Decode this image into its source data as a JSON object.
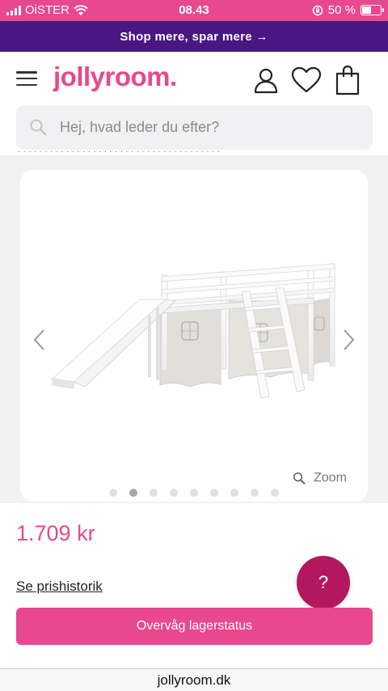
{
  "status_bar": {
    "carrier": "OiSTER",
    "time": "08.43",
    "battery_percent": "50 %",
    "battery_level": 0.5
  },
  "promo": {
    "text": "Shop mere, spar mere →"
  },
  "header": {
    "logo": "jollyroom.",
    "brand_color": "#e8488d"
  },
  "search": {
    "placeholder": "Hej, hvad leder du efter?"
  },
  "gallery": {
    "zoom_label": "Zoom",
    "image_count": 9,
    "active_index": 1
  },
  "product": {
    "price": "1.709 kr",
    "price_history_link": "Se prishistorik",
    "watch_button": "Overvåg lagerstatus",
    "help_label": "?"
  },
  "browser": {
    "url": "jollyroom.dk"
  },
  "icons": [
    "menu-icon",
    "user-icon",
    "heart-icon",
    "shopping-bag-icon",
    "search-icon",
    "zoom-icon",
    "chevron-left-icon",
    "chevron-right-icon",
    "wifi-icon",
    "lock-rotation-icon"
  ]
}
